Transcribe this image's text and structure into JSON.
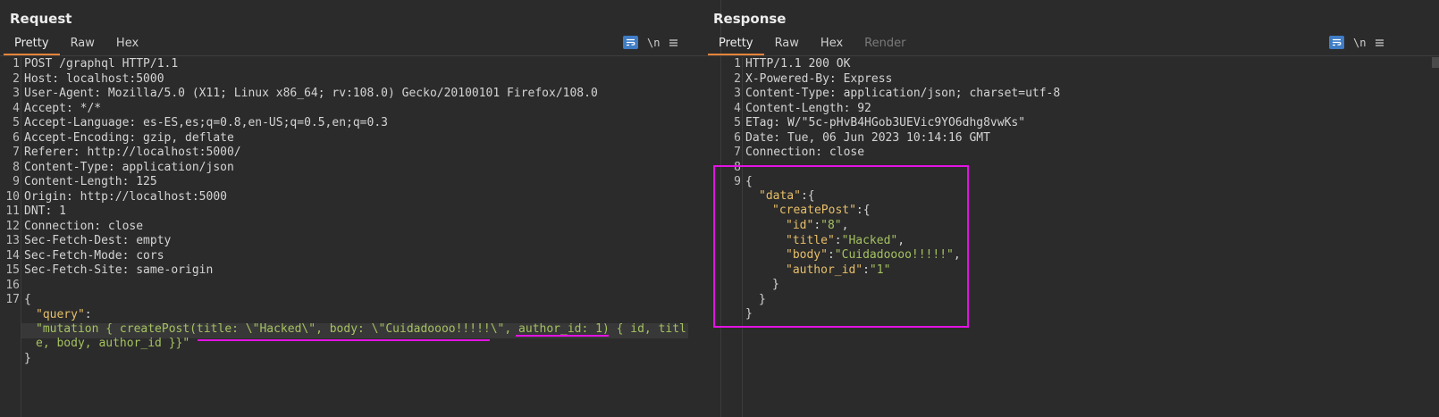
{
  "request": {
    "title": "Request",
    "tabs": [
      "Pretty",
      "Raw",
      "Hex"
    ],
    "line_numbers": [
      "1",
      "2",
      "3",
      "4",
      "5",
      "6",
      "7",
      "8",
      "9",
      "10",
      "11",
      "12",
      "13",
      "14",
      "15",
      "16",
      "17"
    ],
    "lines": [
      "POST /graphql HTTP/1.1",
      "Host: localhost:5000",
      "User-Agent: Mozilla/5.0 (X11; Linux x86_64; rv:108.0) Gecko/20100101 Firefox/108.0",
      "Accept: */*",
      "Accept-Language: es-ES,es;q=0.8,en-US;q=0.5,en;q=0.3",
      "Accept-Encoding: gzip, deflate",
      "Referer: http://localhost:5000/",
      "Content-Type: application/json",
      "Content-Length: 125",
      "Origin: http://localhost:5000",
      "DNT: 1",
      "Connection: close",
      "Sec-Fetch-Dest: empty",
      "Sec-Fetch-Mode: cors",
      "Sec-Fetch-Site: same-origin",
      "",
      "{"
    ],
    "body_key": "\"query\"",
    "body_colon": ":",
    "body_value_1": "\"mutation { createPost(title: \\\"Hacked\\\", body: \\\"Cuidadoooo!!!!!\\\", author_id: 1) { id, titl",
    "body_value_2": "e, body, author_id }}\"",
    "body_close": "}"
  },
  "response": {
    "title": "Response",
    "tabs": [
      "Pretty",
      "Raw",
      "Hex",
      "Render"
    ],
    "line_numbers": [
      "1",
      "2",
      "3",
      "4",
      "5",
      "6",
      "7",
      "8",
      "9"
    ],
    "lines": [
      "HTTP/1.1 200 OK",
      "X-Powered-By: Express",
      "Content-Type: application/json; charset=utf-8",
      "Content-Length: 92",
      "ETag: W/\"5c-pHvB4HGob3UEVic9YO6dhg8vwKs\"",
      "Date: Tue, 06 Jun 2023 10:14:16 GMT",
      "Connection: close",
      "",
      "{"
    ],
    "json": {
      "data_key": "\"data\"",
      "createPost_key": "\"createPost\"",
      "id_key": "\"id\"",
      "id_val": "\"8\"",
      "title_key": "\"title\"",
      "title_val": "\"Hacked\"",
      "body_key": "\"body\"",
      "body_val": "\"Cuidadoooo!!!!!\"",
      "author_key": "\"author_id\"",
      "author_val": "\"1\"",
      "open": ":{",
      "colon": ":",
      "comma": ",",
      "close_inner": "}",
      "close_mid": "}",
      "close_outer": "}"
    }
  },
  "tools": {
    "wrap_icon": "wrap-lines-icon",
    "newline_label": "\\n",
    "menu_icon": "hamburger-menu-icon"
  },
  "layout_buttons": [
    "side-by-side-layout-icon",
    "stacked-layout-icon",
    "single-pane-layout-icon"
  ],
  "colors": {
    "accent": "#e8833a",
    "highlight_magenta": "#e312e3",
    "json_key": "#e8bf6a",
    "json_string": "#a5c261",
    "button_blue": "#3f7dc5"
  }
}
